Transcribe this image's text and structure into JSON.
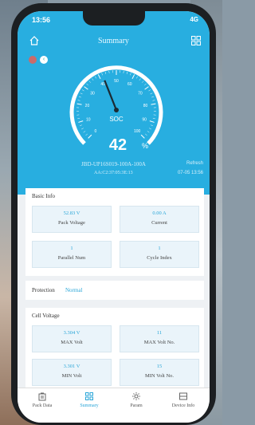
{
  "status_bar": {
    "time": "13:56",
    "indicators": "4G"
  },
  "header": {
    "title": "Summary"
  },
  "gauge": {
    "label": "SOC",
    "value": "42",
    "unit": "%",
    "soc_value": 42,
    "ticks": [
      "0",
      "10",
      "20",
      "30",
      "40",
      "50",
      "60",
      "70",
      "80",
      "90",
      "100"
    ]
  },
  "device": {
    "id": "JBD-UP16S019-100A-100A",
    "mac": "AA:C2:37:05:3E:13",
    "refresh_label": "Refresh",
    "time": "07-05 13:56"
  },
  "basic_info": {
    "title": "Basic Info",
    "tiles": [
      {
        "value": "52.83 V",
        "label": "Pack Voltage"
      },
      {
        "value": "0.00 A",
        "label": "Current"
      },
      {
        "value": "1",
        "label": "Parallel Num"
      },
      {
        "value": "1",
        "label": "Cycle Index"
      }
    ]
  },
  "protection": {
    "label": "Protection",
    "value": "Normal"
  },
  "cell_voltage": {
    "title": "Cell Voltage",
    "tiles": [
      {
        "value": "3.304 V",
        "label": "MAX Volt"
      },
      {
        "value": "11",
        "label": "MAX Volt No."
      },
      {
        "value": "3.301 V",
        "label": "MIN Volt"
      },
      {
        "value": "15",
        "label": "MIN Volt No."
      }
    ]
  },
  "nav": {
    "items": [
      {
        "label": "Pack Data"
      },
      {
        "label": "Summary"
      },
      {
        "label": "Param"
      },
      {
        "label": "Device Info"
      }
    ]
  },
  "colors": {
    "accent": "#28aee0",
    "active_nav": "#2aa6d8"
  }
}
